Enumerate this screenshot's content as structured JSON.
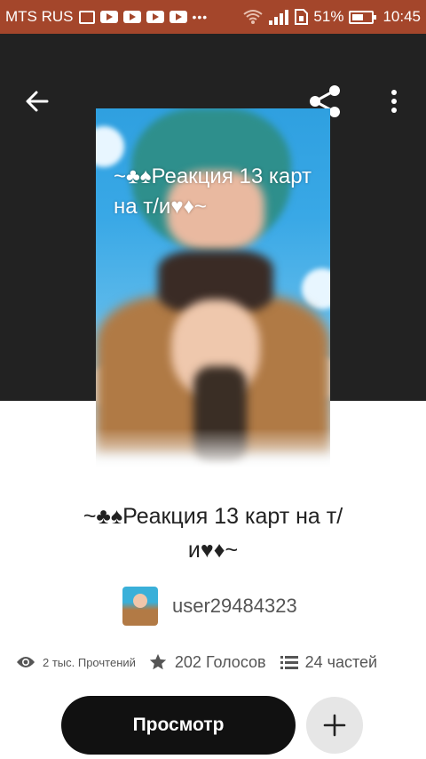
{
  "status_bar": {
    "carrier": "MTS RUS",
    "battery": "51%",
    "time": "10:45",
    "icons": [
      "image-icon",
      "youtube-icon",
      "youtube-icon",
      "youtube-icon",
      "youtube-icon",
      "more-dots-icon",
      "wifi-icon",
      "signal-icon",
      "sim-icon",
      "battery-icon"
    ]
  },
  "header": {
    "back_icon": "arrow-left-icon",
    "share_icon": "share-icon",
    "menu_icon": "more-vertical-icon",
    "background": "#222222"
  },
  "cover": {
    "text": "~♣♠Реакция 13 карт на т/и♥♦~"
  },
  "story": {
    "title_line1": "~♣♠Реакция 13 карт на т/",
    "title_line2": "и♥♦~",
    "author": "user29484323"
  },
  "stats": {
    "reads": "2 тыс. Прочтений",
    "votes": "202 Голосов",
    "parts": "24 частей"
  },
  "actions": {
    "read_label": "Просмотр",
    "add_icon": "plus-icon"
  },
  "colors": {
    "status_bar": "#a4462b",
    "primary_button": "#111111",
    "secondary_button": "#e6e6e6"
  }
}
